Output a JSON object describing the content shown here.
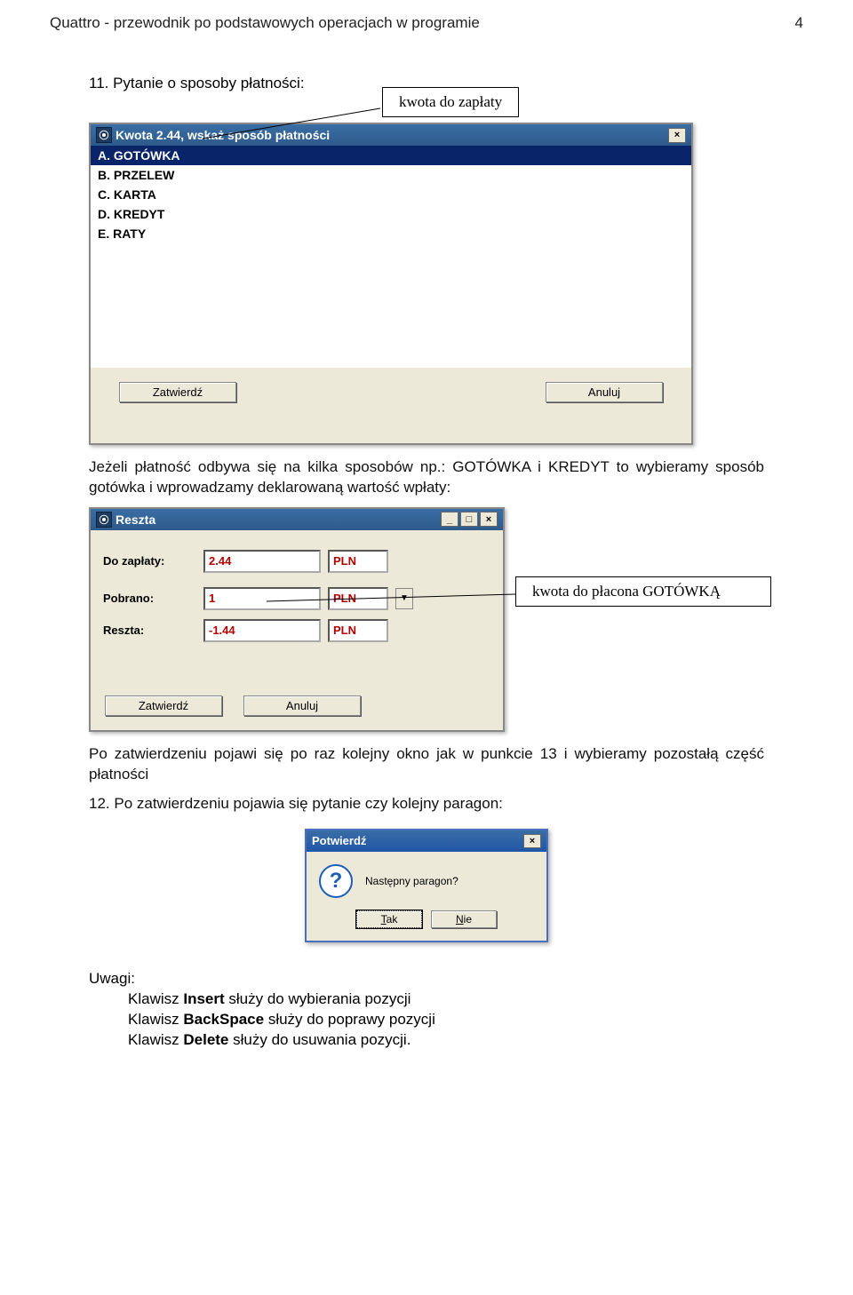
{
  "header": {
    "title": "Quattro - przewodnik po podstawowych operacjach w programie",
    "page_no": "4"
  },
  "section11": {
    "heading": "11. Pytanie o sposoby płatności:",
    "callout": "kwota do zapłaty",
    "dialog_title": "Kwota 2.44, wskaż sposób płatności",
    "options": {
      "a": "A. GOTÓWKA",
      "b": "B. PRZELEW",
      "c": "C. KARTA",
      "d": "D. KREDYT",
      "e": "E. RATY"
    },
    "confirm": "Zatwierdź",
    "cancel": "Anuluj"
  },
  "para1": "Jeżeli płatność odbywa się na kilka sposobów np.: GOTÓWKA i KREDYT to wybieramy sposób gotówka i wprowadzamy deklarowaną wartość wpłaty:",
  "reszta": {
    "title": "Reszta",
    "rows": {
      "do_zaplaty": {
        "label": "Do zapłaty:",
        "value": "2.44",
        "currency": "PLN"
      },
      "pobrano": {
        "label": "Pobrano:",
        "value": "1",
        "currency": "PLN"
      },
      "reszta": {
        "label": "Reszta:",
        "value": "-1.44",
        "currency": "PLN"
      }
    },
    "callout": "kwota do płacona GOTÓWKĄ",
    "confirm": "Zatwierdź",
    "cancel": "Anuluj"
  },
  "para2": "Po zatwierdzeniu pojawi się po raz kolejny okno jak w punkcie 13 i wybieramy pozostałą część płatności",
  "section12": "12. Po zatwierdzeniu pojawia się pytanie czy kolejny paragon:",
  "confirm_dlg": {
    "title": "Potwierdź",
    "msg": "Następny paragon?",
    "yes": "Tak",
    "yes_key": "T",
    "no": "Nie",
    "no_key": "N"
  },
  "notes": {
    "heading": "Uwagi:",
    "l1a": "Klawisz ",
    "l1b": "Insert",
    "l1c": " służy do wybierania pozycji",
    "l2a": "Klawisz ",
    "l2b": "BackSpace",
    "l2c": " służy do poprawy pozycji",
    "l3a": "Klawisz ",
    "l3b": "Delete",
    "l3c": " służy do usuwania pozycji."
  }
}
